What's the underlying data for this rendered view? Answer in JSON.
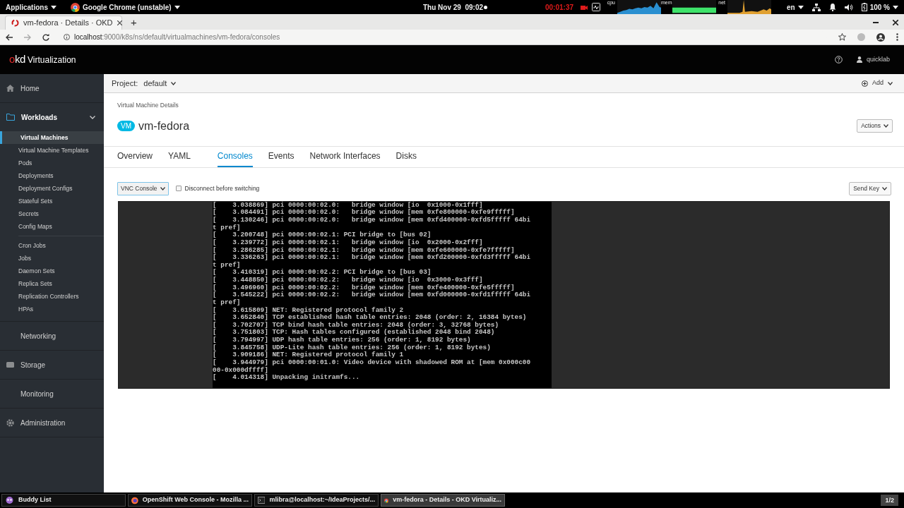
{
  "system_bar": {
    "menus": [
      {
        "label": "Applications",
        "kind": "plain"
      },
      {
        "label": "Google Chrome (unstable)",
        "kind": "chrome"
      }
    ],
    "clock": "Thu Nov 29  09:02",
    "recording": "00:01:37",
    "monitors": [
      {
        "label": "cpu",
        "color": "#2a8fd0"
      },
      {
        "label": "mem",
        "color": "#3ee36a"
      },
      {
        "label": "net",
        "color": "#e0a030"
      }
    ],
    "language": "en",
    "battery": "100 %"
  },
  "browser": {
    "tab_title": "vm-fedora · Details · OKD",
    "new_tab": "+",
    "url_host": "localhost",
    "url_path": ":9000/k8s/ns/default/virtualmachines/vm-fedora/consoles"
  },
  "masthead": {
    "logo": "okd",
    "product": "Virtualization",
    "user": "quicklab"
  },
  "sidebar": [
    {
      "label": "Home",
      "kind": "home",
      "expanded": false
    },
    {
      "label": "Workloads",
      "kind": "folder",
      "expanded": true,
      "groups": [
        [
          {
            "label": "Virtual Machines",
            "selected": true
          },
          {
            "label": "Virtual Machine Templates",
            "selected": false
          },
          {
            "label": "Pods",
            "selected": false
          },
          {
            "label": "Deployments",
            "selected": false
          },
          {
            "label": "Deployment Configs",
            "selected": false
          },
          {
            "label": "Stateful Sets",
            "selected": false
          },
          {
            "label": "Secrets",
            "selected": false
          },
          {
            "label": "Config Maps",
            "selected": false
          }
        ],
        [
          {
            "label": "Cron Jobs",
            "selected": false
          },
          {
            "label": "Jobs",
            "selected": false
          },
          {
            "label": "Daemon Sets",
            "selected": false
          },
          {
            "label": "Replica Sets",
            "selected": false
          },
          {
            "label": "Replication Controllers",
            "selected": false
          },
          {
            "label": "HPAs",
            "selected": false
          }
        ]
      ]
    },
    {
      "label": "Networking",
      "kind": "plain",
      "expanded": false
    },
    {
      "label": "Storage",
      "kind": "storage",
      "expanded": false
    },
    {
      "label": "Monitoring",
      "kind": "plain",
      "expanded": false
    },
    {
      "label": "Administration",
      "kind": "admin",
      "expanded": false
    }
  ],
  "project": {
    "label": "Project:",
    "value": "default"
  },
  "add": "Add",
  "page": {
    "breadcrumb": "Virtual Machine Details",
    "badge": "VM",
    "name": "vm-fedora",
    "actions": "Actions"
  },
  "tabs": [
    {
      "label": "Overview",
      "selected": false
    },
    {
      "label": "YAML",
      "selected": false
    },
    {
      "label": "Consoles",
      "selected": true
    },
    {
      "label": "Events",
      "selected": false
    },
    {
      "label": "Network Interfaces",
      "selected": false
    },
    {
      "label": "Disks",
      "selected": false
    }
  ],
  "console": {
    "type": "VNC Console",
    "disconnect": {
      "label": "Disconnect before switching",
      "checked": false
    },
    "send_key": "Send Key",
    "lines": [
      "[    3.038869] pci 0000:00:02.0:   bridge window [io  0x1000-0x1fff]",
      "[    3.084491] pci 0000:00:02.0:   bridge window [mem 0xfe800000-0xfe9fffff]",
      "[    3.130246] pci 0000:00:02.0:   bridge window [mem 0xfd400000-0xfd5fffff 64bi",
      "t pref]",
      "[    3.200748] pci 0000:00:02.1: PCI bridge to [bus 02]",
      "[    3.239772] pci 0000:00:02.1:   bridge window [io  0x2000-0x2fff]",
      "[    3.286285] pci 0000:00:02.1:   bridge window [mem 0xfe600000-0xfe7fffff]",
      "[    3.336263] pci 0000:00:02.1:   bridge window [mem 0xfd200000-0xfd3fffff 64bi",
      "t pref]",
      "[    3.410319] pci 0000:00:02.2: PCI bridge to [bus 03]",
      "[    3.448850] pci 0000:00:02.2:   bridge window [io  0x3000-0x3fff]",
      "[    3.496960] pci 0000:00:02.2:   bridge window [mem 0xfe400000-0xfe5fffff]",
      "[    3.545222] pci 0000:00:02.2:   bridge window [mem 0xfd000000-0xfd1fffff 64bi",
      "t pref]",
      "[    3.615809] NET: Registered protocol family 2",
      "[    3.652840] TCP established hash table entries: 2048 (order: 2, 16384 bytes)",
      "[    3.702707] TCP bind hash table entries: 2048 (order: 3, 32768 bytes)",
      "[    3.751803] TCP: Hash tables configured (established 2048 bind 2048)",
      "[    3.794997] UDP hash table entries: 256 (order: 1, 8192 bytes)",
      "[    3.845758] UDP-Lite hash table entries: 256 (order: 1, 8192 bytes)",
      "[    3.909186] NET: Registered protocol family 1",
      "[    3.944979] pci 0000:00:01.0: Video device with shadowed ROM at [mem 0x000c00",
      "00-0x000dffff]",
      "[    4.014318] Unpacking initramfs..."
    ]
  },
  "taskbar": {
    "items": [
      {
        "label": "Buddy List",
        "kind": "chat",
        "selected": false
      },
      {
        "label": "OpenShift Web Console - Mozilla ...",
        "kind": "firefox",
        "selected": false
      },
      {
        "label": "mlibra@localhost:~/IdeaProjects/...",
        "kind": "terminal",
        "selected": false
      },
      {
        "label": "vm-fedora - Details - OKD Virtualiz...",
        "kind": "chrome",
        "selected": true
      }
    ],
    "pager": "1/2"
  }
}
